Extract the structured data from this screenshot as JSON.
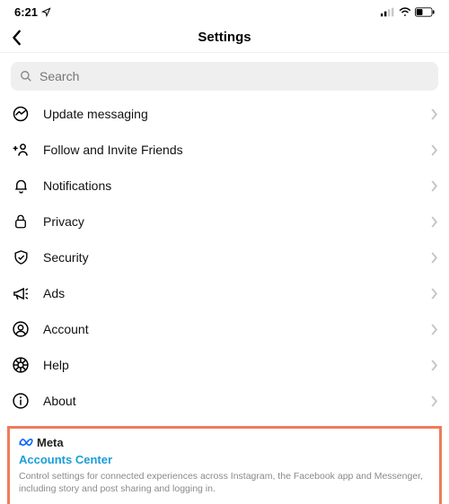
{
  "statusbar": {
    "time": "6:21"
  },
  "header": {
    "title": "Settings"
  },
  "search": {
    "placeholder": "Search"
  },
  "settings": {
    "items": [
      {
        "icon": "messenger-icon",
        "label": "Update messaging"
      },
      {
        "icon": "add-friend-icon",
        "label": "Follow and Invite Friends"
      },
      {
        "icon": "bell-icon",
        "label": "Notifications"
      },
      {
        "icon": "lock-icon",
        "label": "Privacy"
      },
      {
        "icon": "shield-icon",
        "label": "Security"
      },
      {
        "icon": "megaphone-icon",
        "label": "Ads"
      },
      {
        "icon": "user-icon",
        "label": "Account"
      },
      {
        "icon": "help-icon",
        "label": "Help"
      },
      {
        "icon": "info-icon",
        "label": "About"
      }
    ]
  },
  "footer": {
    "brand": "Meta",
    "link": "Accounts Center",
    "desc": "Control settings for connected experiences across Instagram, the Facebook app and Messenger, including story and post sharing and logging in."
  }
}
